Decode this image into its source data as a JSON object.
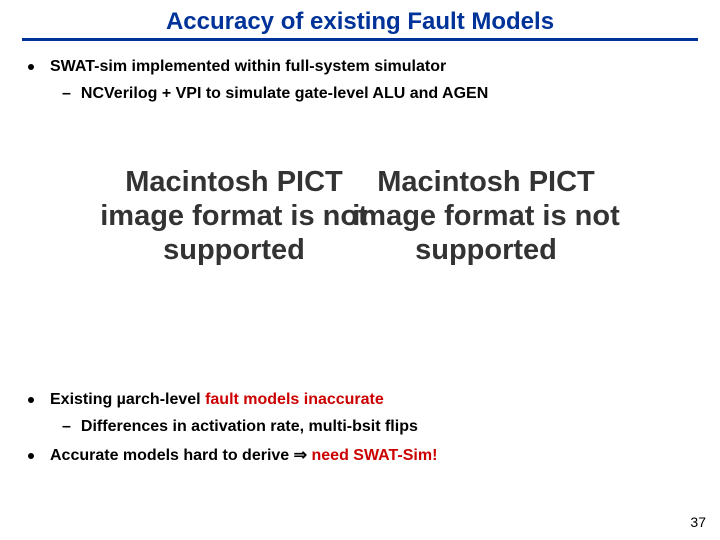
{
  "title": "Accuracy of existing Fault Models",
  "bullets": {
    "b1": "SWAT-sim implemented within full-system simulator",
    "b1a": "NCVerilog + VPI to simulate gate-level ALU and AGEN",
    "b2_pre": "Existing µarch-level ",
    "b2_hl": "fault models inaccurate",
    "b2a": "Differences in activation rate, multi-bsit flips",
    "b3_pre": "Accurate models hard to derive ",
    "b3_arrow": "⇒",
    "b3_hl": " need SWAT-Sim!"
  },
  "pict_text": "Macintosh PICT image format is not supported",
  "page_number": "37"
}
